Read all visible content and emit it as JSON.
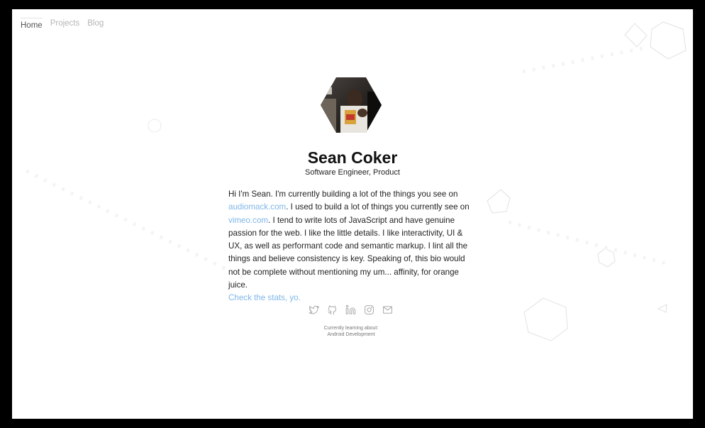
{
  "nav": {
    "home": "Home",
    "projects": "Projects",
    "blog": "Blog"
  },
  "profile": {
    "name": "Sean Coker",
    "title": "Software Engineer, Product"
  },
  "bio": {
    "part1": "Hi I'm Sean. I'm currently building a lot of the things you see on ",
    "link1": "audiomack.com",
    "part2": ". I used to build a lot of things you currently see on ",
    "link2": "vimeo.com",
    "part3": ". I tend to write lots of JavaScript and have genuine passion for the web. I like the little details. I like interactivity, UI & UX, as well as performant code and semantic markup. I lint all the things and believe consistency is key. Speaking of, this bio would not be complete without mentioning my um... affinity, for orange juice.",
    "stats_link": "Check the stats, yo."
  },
  "social": [
    "twitter-icon",
    "github-icon",
    "linkedin-icon",
    "instagram-icon",
    "mail-icon"
  ],
  "learning": {
    "label": "Currently learning about:",
    "topic": "Android Development"
  },
  "colors": {
    "link": "#7fb6e8",
    "text": "#222222",
    "nav_inactive": "#b5b5b5",
    "icon": "#a9a9a9"
  }
}
